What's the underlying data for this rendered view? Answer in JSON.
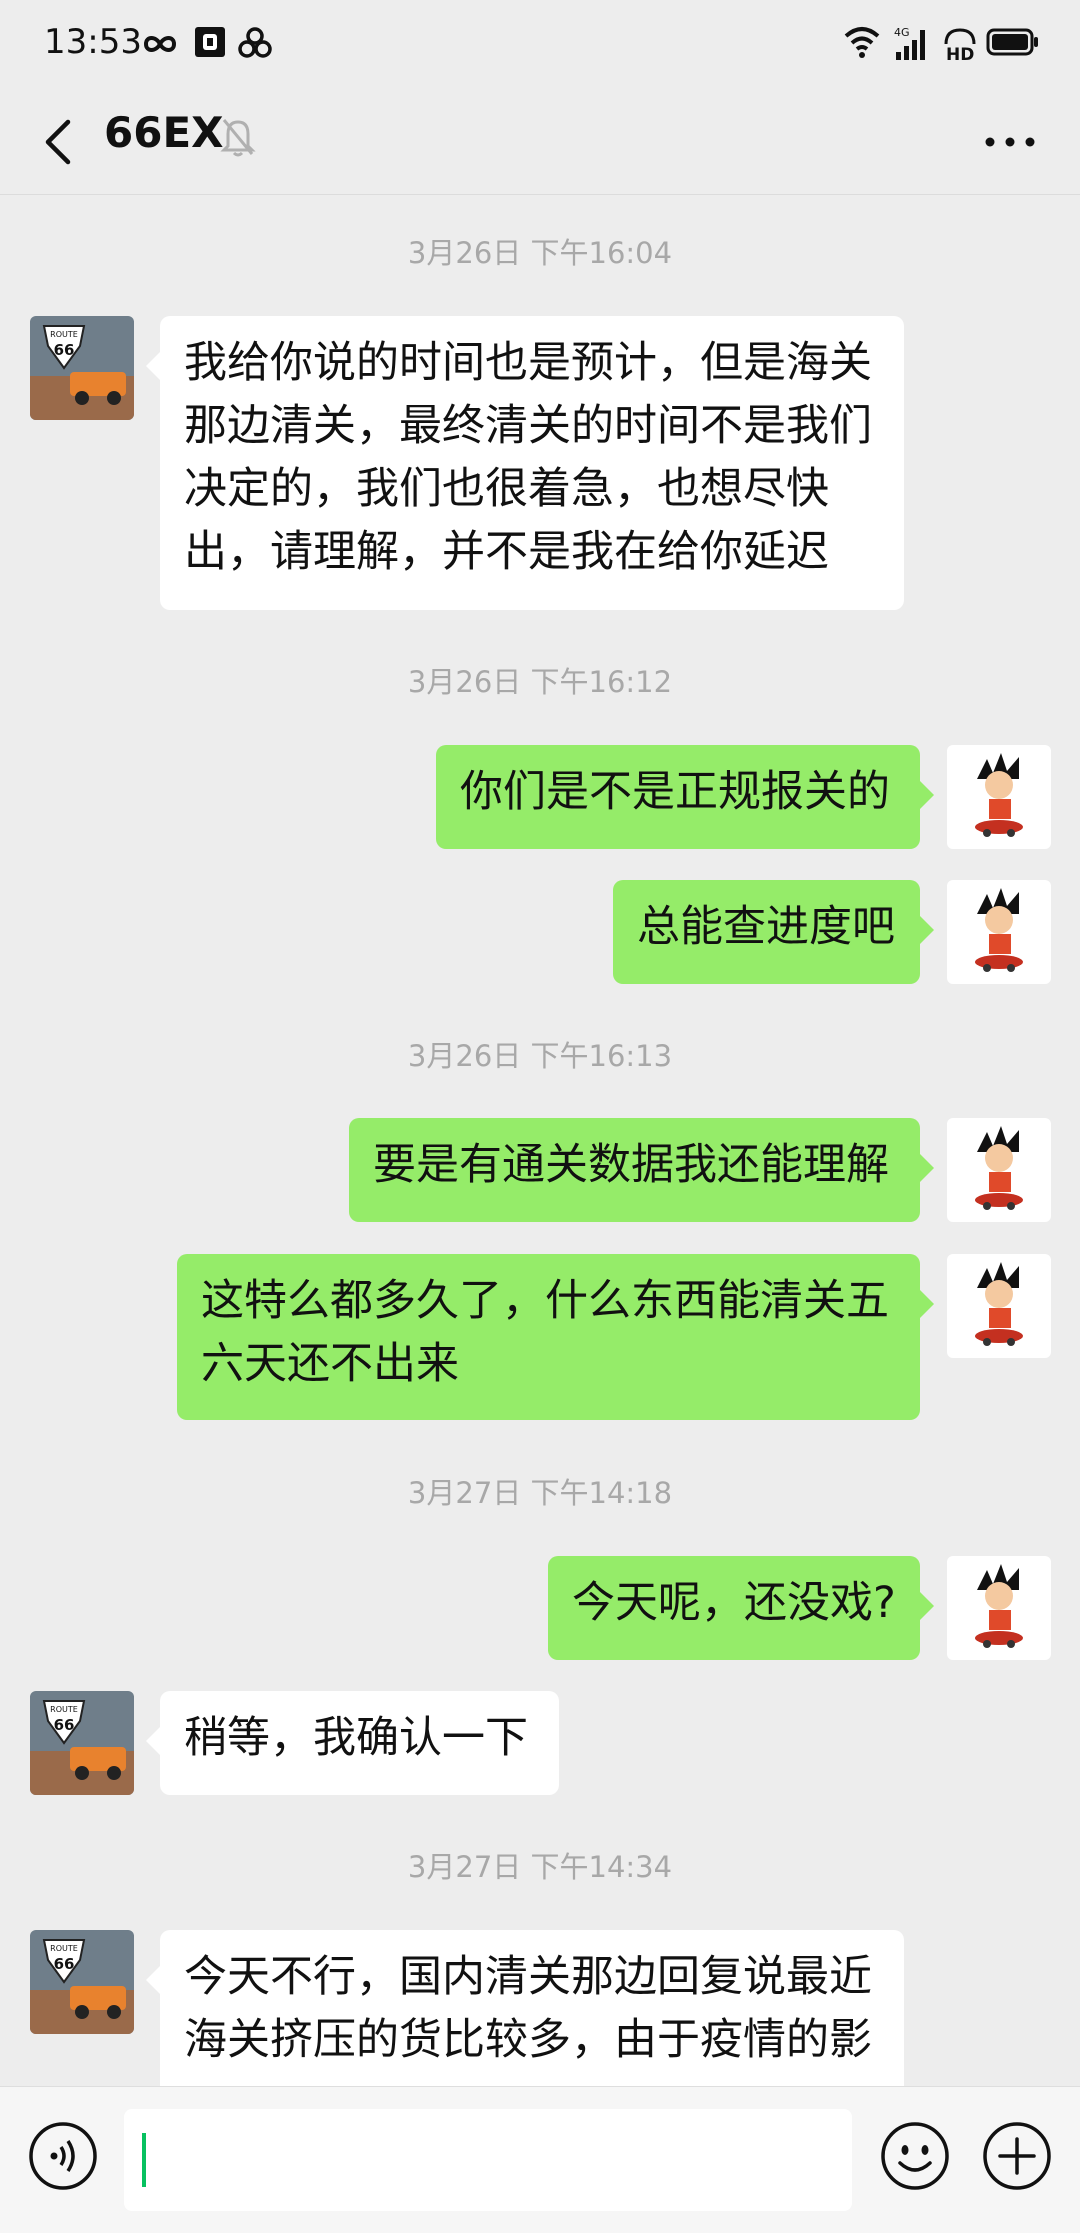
{
  "status_bar": {
    "time": "13:53",
    "icons": [
      "infinity-icon",
      "shield-app-icon",
      "pinwheel-icon",
      "wifi-icon",
      "signal-4g-icon",
      "hd-icon",
      "battery-icon"
    ],
    "network": "4G",
    "hd": "HD"
  },
  "header": {
    "title": "66EX",
    "back_icon": "chevron-left-icon",
    "mute_icon": "bell-muted-icon",
    "more_icon": "more-dots-icon"
  },
  "contact_avatar": {
    "sign_top": "ROUTE",
    "sign_number": "66"
  },
  "messages": [
    {
      "type": "timestamp",
      "text": "3月26日 下午16:04"
    },
    {
      "type": "in",
      "text": "我给你说的时间也是预计，但是海关\n那边清关，最终清关的时间不是我们\n决定的，我们也很着急，也想尽快\n出，请理解，并不是我在给你延迟"
    },
    {
      "type": "timestamp",
      "text": "3月26日 下午16:12"
    },
    {
      "type": "out",
      "text": "你们是不是正规报关的"
    },
    {
      "type": "out",
      "text": "总能查进度吧"
    },
    {
      "type": "timestamp",
      "text": "3月26日 下午16:13"
    },
    {
      "type": "out",
      "text": "要是有通关数据我还能理解"
    },
    {
      "type": "out",
      "text": "这特么都多久了，什么东西能清关五\n六天还不出来"
    },
    {
      "type": "timestamp",
      "text": "3月27日 下午14:18"
    },
    {
      "type": "out",
      "text": "今天呢，还没戏?"
    },
    {
      "type": "in",
      "text": "稍等，我确认一下"
    },
    {
      "type": "timestamp",
      "text": "3月27日 下午14:34"
    },
    {
      "type": "in",
      "text": "今天不行，国内清关那边回复说最近\n海关挤压的货比较多，由于疫情的影"
    }
  ],
  "input_bar": {
    "voice_icon": "voice-icon",
    "input_value": "",
    "emoji_icon": "emoji-icon",
    "plus_icon": "plus-icon"
  },
  "colors": {
    "background": "#ededed",
    "outgoing_bubble": "#95ec69",
    "incoming_bubble": "#ffffff",
    "timestamp": "#a8a8a8",
    "cursor": "#07c160"
  }
}
